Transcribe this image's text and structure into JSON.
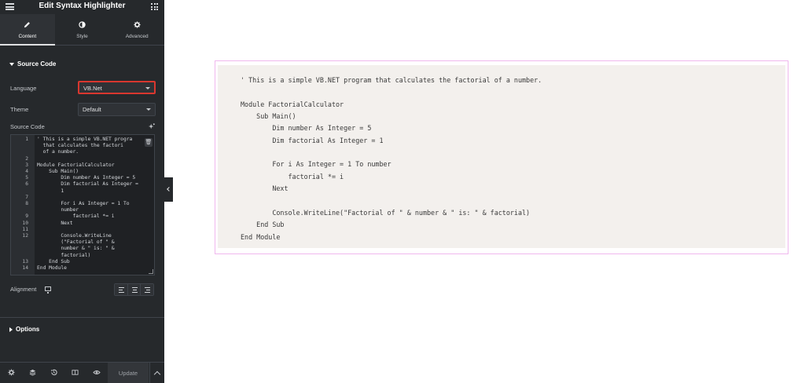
{
  "panel": {
    "title": "Edit Syntax Highlighter",
    "tabs": [
      {
        "label": "Content",
        "icon": "pencil-icon",
        "active": true
      },
      {
        "label": "Style",
        "icon": "contrast-icon",
        "active": false
      },
      {
        "label": "Advanced",
        "icon": "gear-icon",
        "active": false
      }
    ],
    "source_section": "Source Code",
    "language": {
      "label": "Language",
      "value": "VB.Net",
      "highlight_color": "#d9372f"
    },
    "theme": {
      "label": "Theme",
      "value": "Default"
    },
    "source_code_label": "Source Code",
    "editor_lines": [
      {
        "num": "1",
        "text": "' This is a simple VB.NET progra"
      },
      {
        "num": "",
        "text": "  that calculates the factori"
      },
      {
        "num": "",
        "text": "  of a number."
      },
      {
        "num": "2",
        "text": ""
      },
      {
        "num": "3",
        "text": "Module FactorialCalculator"
      },
      {
        "num": "4",
        "text": "    Sub Main()"
      },
      {
        "num": "5",
        "text": "        Dim number As Integer = 5"
      },
      {
        "num": "6",
        "text": "        Dim factorial As Integer ="
      },
      {
        "num": "",
        "text": "        1"
      },
      {
        "num": "7",
        "text": ""
      },
      {
        "num": "8",
        "text": "        For i As Integer = 1 To"
      },
      {
        "num": "",
        "text": "        number"
      },
      {
        "num": "9",
        "text": "            factorial *= i"
      },
      {
        "num": "10",
        "text": "        Next"
      },
      {
        "num": "11",
        "text": ""
      },
      {
        "num": "12",
        "text": "        Console.WriteLine"
      },
      {
        "num": "",
        "text": "        (\"Factorial of \" &"
      },
      {
        "num": "",
        "text": "        number & \" is: \" &"
      },
      {
        "num": "",
        "text": "        factorial)"
      },
      {
        "num": "13",
        "text": "    End Sub"
      },
      {
        "num": "14",
        "text": "End Module"
      }
    ],
    "alignment_label": "Alignment",
    "options_section": "Options",
    "footer": {
      "update_label": "Update"
    }
  },
  "preview": {
    "code_lines": [
      "' This is a simple VB.NET program that calculates the factorial of a number.",
      "",
      "Module FactorialCalculator",
      "    Sub Main()",
      "        Dim number As Integer = 5",
      "        Dim factorial As Integer = 1",
      "",
      "        For i As Integer = 1 To number",
      "            factorial *= i",
      "        Next",
      "",
      "        Console.WriteLine(\"Factorial of \" & number & \" is: \" & factorial)",
      "    End Sub",
      "End Module"
    ]
  }
}
